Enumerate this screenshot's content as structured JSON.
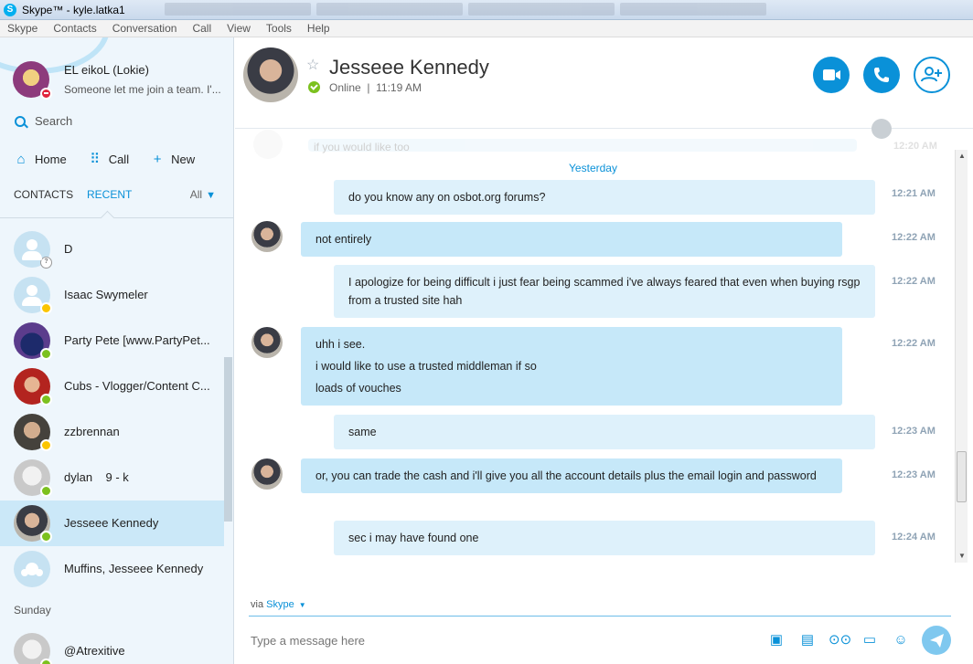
{
  "window": {
    "title": "Skype™ - kyle.latka1"
  },
  "menu": [
    "Skype",
    "Contacts",
    "Conversation",
    "Call",
    "View",
    "Tools",
    "Help"
  ],
  "profile": {
    "name": "EL eikoL (Lokie)",
    "mood": "Someone let me join a team. I'..."
  },
  "search": {
    "label": "Search"
  },
  "nav": {
    "home": "Home",
    "call": "Call",
    "new": "New"
  },
  "tabs": {
    "contacts": "CONTACTS",
    "recent": "RECENT",
    "filter": "All"
  },
  "contacts": [
    {
      "name": "D",
      "status": "unknown"
    },
    {
      "name": "Isaac Swymeler",
      "status": "away"
    },
    {
      "name": "Party Pete [www.PartyPet...",
      "status": "online"
    },
    {
      "name": "Cubs - Vlogger/Content C...",
      "status": "online"
    },
    {
      "name": "zzbrennan",
      "status": "away"
    },
    {
      "name": "dylan    9 - k",
      "status": "online"
    },
    {
      "name": "Jesseee Kennedy",
      "status": "online",
      "selected": true
    },
    {
      "name": "Muffins, Jesseee Kennedy",
      "status": "group"
    }
  ],
  "section_sunday": "Sunday",
  "contacts_sunday": [
    {
      "name": "@Atrexitive",
      "status": "online"
    }
  ],
  "header": {
    "name": "Jesseee Kennedy",
    "status": "Online  |  11:19 AM"
  },
  "conversation": {
    "faded_text": "if you would like too",
    "faded_time": "12:20 AM",
    "day": "Yesterday",
    "messages": [
      {
        "dir": "out",
        "lines": [
          "do you know any on osbot.org forums?"
        ],
        "time": "12:21 AM"
      },
      {
        "dir": "in",
        "lines": [
          "not entirely"
        ],
        "time": "12:22 AM"
      },
      {
        "dir": "out",
        "lines": [
          "I apologize for being difficult i just fear being scammed i've always feared that even when buying rsgp from a trusted site hah"
        ],
        "time": "12:22 AM"
      },
      {
        "dir": "in",
        "lines": [
          "uhh i see.",
          "i would like to use a trusted middleman if so",
          "loads of vouches"
        ],
        "time": "12:22 AM"
      },
      {
        "dir": "out",
        "lines": [
          "same"
        ],
        "time": "12:23 AM"
      },
      {
        "dir": "in",
        "lines": [
          "or, you can trade the cash and i'll give you all the account details plus the email login and password"
        ],
        "time": "12:23 AM"
      },
      {
        "dir": "out",
        "lines": [
          "sec i may have found one"
        ],
        "time": "12:24 AM"
      }
    ]
  },
  "compose": {
    "via": "via",
    "service": "Skype",
    "placeholder": "Type a message here"
  }
}
